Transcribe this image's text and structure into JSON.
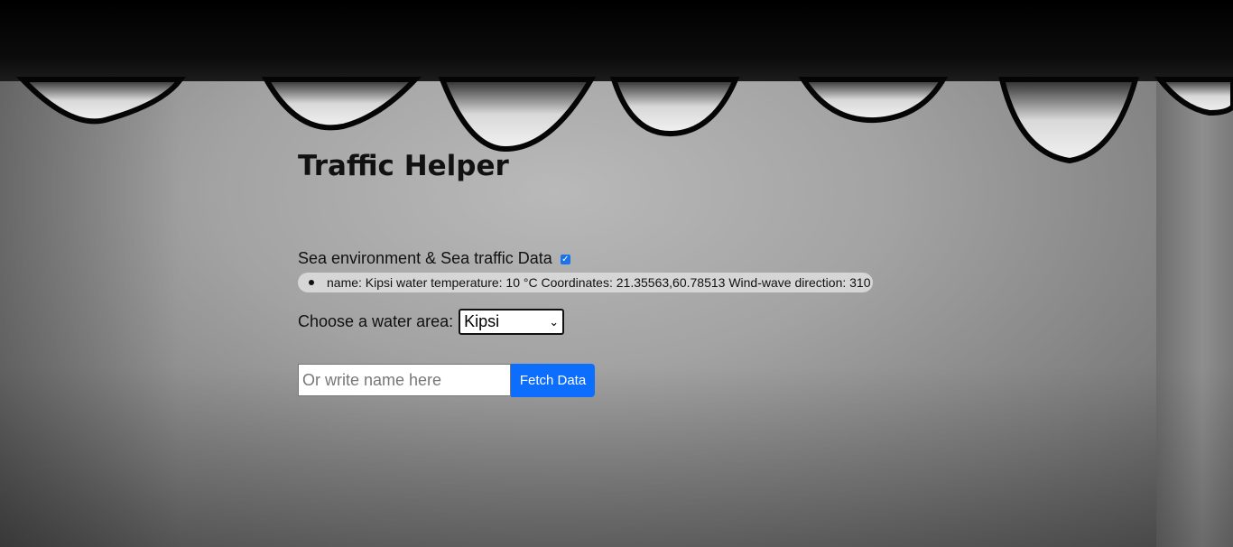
{
  "page": {
    "title": "Traffic Helper"
  },
  "sea_data": {
    "label": "Sea environment & Sea traffic Data",
    "checked": true,
    "items": [
      "name: Kipsi water temperature: 10 °C Coordinates: 21.35563,60.78513 Wind-wave direction: 310"
    ]
  },
  "water_area": {
    "label": "Choose a water area:",
    "selected": "Kipsi"
  },
  "search": {
    "placeholder": "Or write name here",
    "value": "",
    "button_label": "Fetch Data"
  },
  "colors": {
    "accent": "#0d6efd",
    "checkbox": "#1a73e8",
    "pill_bg": "#d6d6d6"
  }
}
